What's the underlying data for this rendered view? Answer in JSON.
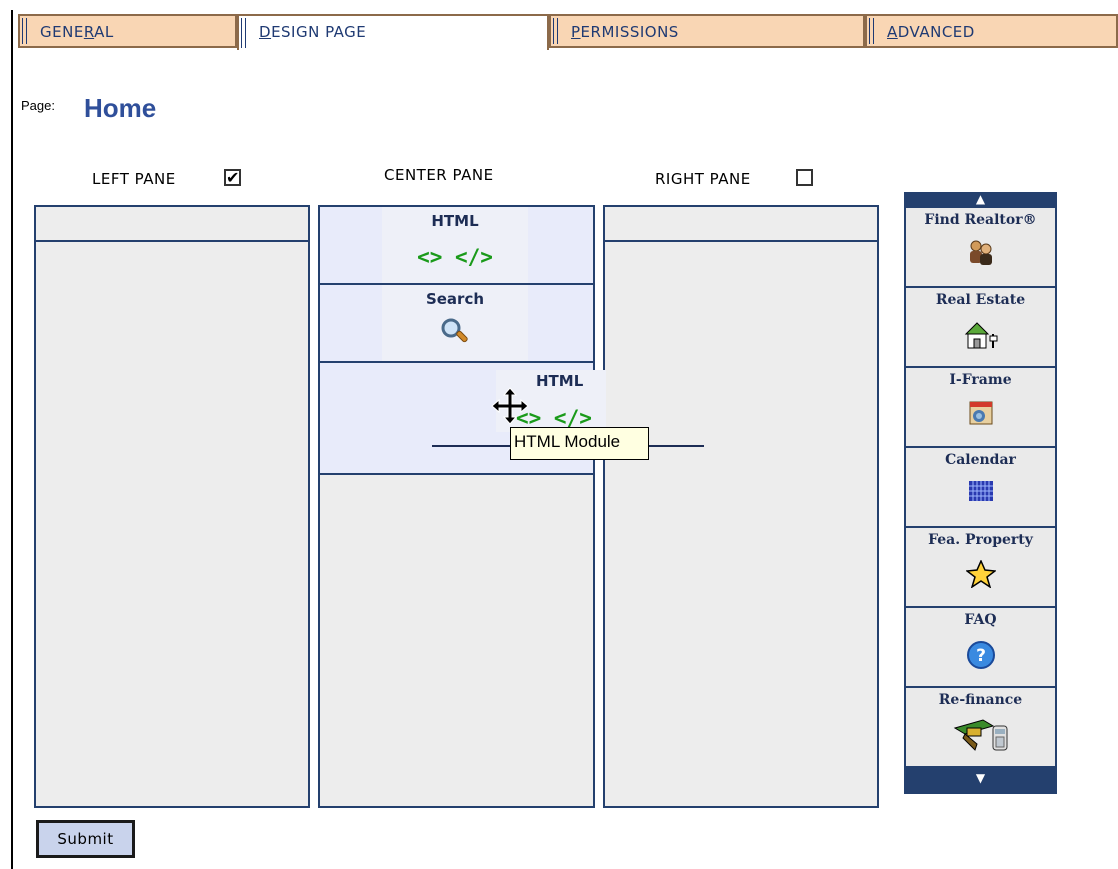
{
  "tabs": [
    {
      "pre": "GENE",
      "u": "R",
      "post": "AL"
    },
    {
      "pre": "",
      "u": "D",
      "post": "ESIGN PAGE"
    },
    {
      "pre": "",
      "u": "P",
      "post": "ERMISSIONS"
    },
    {
      "pre": "",
      "u": "A",
      "post": "DVANCED"
    }
  ],
  "page": {
    "label": "Page:",
    "name": "Home"
  },
  "panes": {
    "left": {
      "label": "LEFT PANE",
      "checked": true
    },
    "center": {
      "label": "CENTER PANE"
    },
    "right": {
      "label": "RIGHT PANE",
      "checked": false
    }
  },
  "center_modules": [
    {
      "title": "HTML",
      "icon": "<> </>",
      "icon_name": "html-code-icon"
    },
    {
      "title": "Search",
      "icon_name": "magnifier-icon"
    }
  ],
  "drag": {
    "title": "HTML",
    "icon": "<> </>",
    "tooltip": "HTML Module"
  },
  "sidebar": {
    "up": "▲",
    "down": "▼",
    "items": [
      {
        "label": "Find Realtor®",
        "icon_name": "people-icon"
      },
      {
        "label": "Real Estate",
        "icon_name": "house-icon"
      },
      {
        "label": "I-Frame",
        "icon_name": "iframe-icon"
      },
      {
        "label": "Calendar",
        "icon_name": "calendar-grid-icon"
      },
      {
        "label": "Fea. Property",
        "icon_name": "star-icon"
      },
      {
        "label": "FAQ",
        "icon_name": "help-icon"
      },
      {
        "label": "Re-finance",
        "icon_name": "money-calculator-icon"
      }
    ]
  },
  "submit_label": "Submit",
  "colors": {
    "tab_bg": "#f9d6b4",
    "navy": "#24406e",
    "html_green": "#1a9a1a",
    "page_title": "#2f4f9a"
  }
}
